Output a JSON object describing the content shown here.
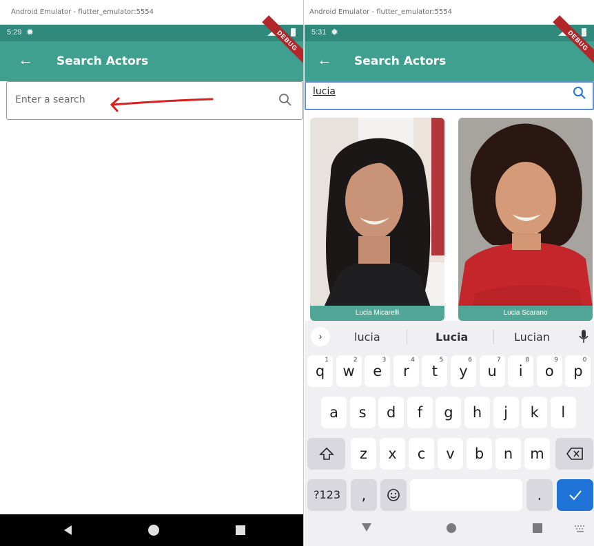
{
  "left": {
    "window_title": "Android Emulator - flutter_emulator:5554",
    "status_time": "5:29",
    "appbar_title": "Search Actors",
    "search_placeholder": "Enter a search"
  },
  "right": {
    "window_title": "Android Emulator - flutter_emulator:5554",
    "status_time": "5:31",
    "appbar_title": "Search Actors",
    "search_value": "lucia",
    "results": [
      {
        "name": "Lucia Micarelli"
      },
      {
        "name": "Lucia Scarano"
      }
    ],
    "suggestions": [
      "lucia",
      "Lucia",
      "Lucian"
    ],
    "keyboard": {
      "row1": [
        {
          "k": "q",
          "n": "1"
        },
        {
          "k": "w",
          "n": "2"
        },
        {
          "k": "e",
          "n": "3"
        },
        {
          "k": "r",
          "n": "4"
        },
        {
          "k": "t",
          "n": "5"
        },
        {
          "k": "y",
          "n": "6"
        },
        {
          "k": "u",
          "n": "7"
        },
        {
          "k": "i",
          "n": "8"
        },
        {
          "k": "o",
          "n": "9"
        },
        {
          "k": "p",
          "n": "0"
        }
      ],
      "row2": [
        "a",
        "s",
        "d",
        "f",
        "g",
        "h",
        "j",
        "k",
        "l"
      ],
      "row3": [
        "z",
        "x",
        "c",
        "v",
        "b",
        "n",
        "m"
      ],
      "symbols_label": "?123",
      "comma_label": ",",
      "period_label": "."
    }
  },
  "debug_banner": "DEBUG",
  "colors": {
    "appbar": "#3fa08f",
    "status_bar": "#2f8a7b",
    "caption": "#52a697",
    "accent_blue": "#1f73d6",
    "arrow_annotation": "#d62020"
  }
}
